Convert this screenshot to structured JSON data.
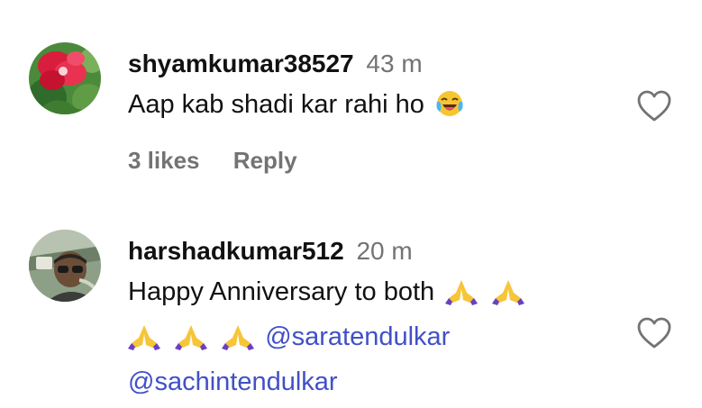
{
  "comments": [
    {
      "username": "shyamkumar38527",
      "time": "43 m",
      "text": "Aap kab shadi kar rahi ho",
      "emoji": "face-with-tears-of-joy-icon",
      "likes": "3 likes",
      "reply": "Reply",
      "avatar": "red-flower-avatar"
    },
    {
      "username": "harshadkumar512",
      "time": "20 m",
      "text": "Happy Anniversary to both",
      "emoji": "folded-hands-icon",
      "mentions": [
        "@saratendulkar",
        "@sachintendulkar"
      ],
      "avatar": "man-in-car-avatar"
    }
  ],
  "colors": {
    "username": "#111111",
    "secondary": "#737373",
    "mention": "#4150c7"
  }
}
